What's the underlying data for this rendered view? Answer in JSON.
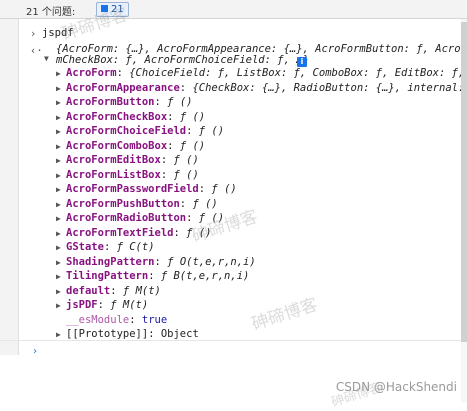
{
  "issues_bar": {
    "label": "21 个问题:",
    "badge_count": "21"
  },
  "input_line": {
    "caret": "›",
    "text": "jspdf"
  },
  "output": {
    "caret": "‹·",
    "summary_1": "{AcroForm: {…}, AcroFormAppearance: {…}, AcroFormButton: ƒ, AcroFor",
    "summary_2": "mCheckBox: ƒ, AcroFormChoiceField: ƒ, …}",
    "info": "i",
    "rows": [
      {
        "key": "AcroForm",
        "value": "{ChoiceField: ƒ, ListBox: ƒ, ComboBox: ƒ, EditBox: ƒ, Bu"
      },
      {
        "key": "AcroFormAppearance",
        "value": "{CheckBox: {…}, RadioButton: {…}, internal: {"
      },
      {
        "key": "AcroFormButton",
        "value": "ƒ ()"
      },
      {
        "key": "AcroFormCheckBox",
        "value": "ƒ ()"
      },
      {
        "key": "AcroFormChoiceField",
        "value": "ƒ ()"
      },
      {
        "key": "AcroFormComboBox",
        "value": "ƒ ()"
      },
      {
        "key": "AcroFormEditBox",
        "value": "ƒ ()"
      },
      {
        "key": "AcroFormListBox",
        "value": "ƒ ()"
      },
      {
        "key": "AcroFormPasswordField",
        "value": "ƒ ()"
      },
      {
        "key": "AcroFormPushButton",
        "value": "ƒ ()"
      },
      {
        "key": "AcroFormRadioButton",
        "value": "ƒ ()"
      },
      {
        "key": "AcroFormTextField",
        "value": "ƒ ()"
      },
      {
        "key": "GState",
        "value": "ƒ C(t)"
      },
      {
        "key": "ShadingPattern",
        "value": "ƒ O(t,e,r,n,i)"
      },
      {
        "key": "TilingPattern",
        "value": "ƒ B(t,e,r,n,i)"
      },
      {
        "key": "default",
        "value": "ƒ M(t)"
      },
      {
        "key": "jsPDF",
        "value": "ƒ M(t)"
      }
    ],
    "esmodule_key": "__esModule",
    "esmodule_value": "true",
    "prototype_key": "[[Prototype]]",
    "prototype_value": "Object"
  },
  "prompt_caret": "›",
  "watermarks": [
    "砷碲博客",
    "砷碲博客",
    "砷碲博客",
    "砷碲博客"
  ],
  "credit": "CSDN @HackShendi",
  "colors": {
    "key": "#881280",
    "accent": "#1a73e8"
  }
}
